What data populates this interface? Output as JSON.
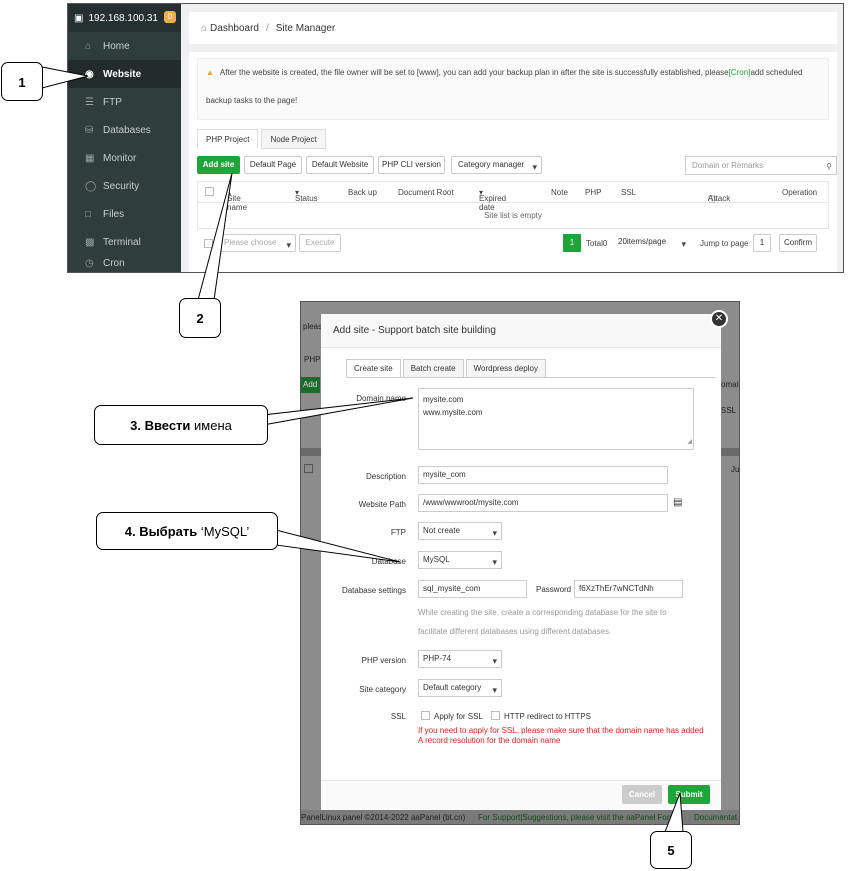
{
  "panel1": {
    "sidebar": {
      "ip": "192.168.100.31",
      "badge": "0",
      "items": [
        {
          "label": "Home",
          "icon": "home-icon"
        },
        {
          "label": "Website",
          "icon": "globe-icon"
        },
        {
          "label": "FTP",
          "icon": "ftp-icon"
        },
        {
          "label": "Databases",
          "icon": "database-icon"
        },
        {
          "label": "Monitor",
          "icon": "monitor-icon"
        },
        {
          "label": "Security",
          "icon": "shield-icon"
        },
        {
          "label": "Files",
          "icon": "folder-icon"
        },
        {
          "label": "Terminal",
          "icon": "terminal-icon"
        },
        {
          "label": "Cron",
          "icon": "cron-icon"
        }
      ]
    },
    "breadcrumb": {
      "home": "Dashboard",
      "sep": "/",
      "current": "Site Manager"
    },
    "notice": {
      "part1": "After the website is created, the file owner will be set to [www], you can add your backup plan in after the site is successfully established, please",
      "cron_link": "[Cron]",
      "part2": "add scheduled",
      "line2": "backup tasks to the page!"
    },
    "tabs": [
      "PHP Project",
      "Node Project"
    ],
    "toolbar": {
      "add_site": "Add site",
      "default_page": "Default Page",
      "default_website": "Default Website",
      "php_cli": "PHP CLI version",
      "category_manager": "Category manager",
      "search_placeholder": "Domain or Remarks"
    },
    "table": {
      "columns": [
        "Site name",
        "Status",
        "Back up",
        "Document Root",
        "Expired date",
        "Note",
        "PHP",
        "SSL",
        "Attack",
        "Operation"
      ],
      "empty": "Site list is empty"
    },
    "footer": {
      "please_choose": "Please choose",
      "execute": "Execute",
      "page": "1",
      "total": "Total0",
      "per_page": "20items/page",
      "jump_to": "Jump to page",
      "jump_value": "1",
      "confirm": "Confirm"
    }
  },
  "panel2": {
    "title": "Add site - Support batch site building",
    "tabs": [
      "Create site",
      "Batch create",
      "Wordpress deploy"
    ],
    "domain_label": "Domain name",
    "domain_value_1": "mysite.com",
    "domain_value_2": "www.mysite.com",
    "description_label": "Description",
    "description_value": "mysite_com",
    "path_label": "Website Path",
    "path_value": "/www/wwwroot/mysite.com",
    "ftp_label": "FTP",
    "ftp_value": "Not create",
    "database_label": "Database",
    "database_value": "MySQL",
    "db_settings_label": "Database settings",
    "db_name_value": "sql_mysite_com",
    "password_label": "Password",
    "password_value": "f6XzThEr7wNCTdNh",
    "db_hint_1": "While creating the site, create a corresponding database for the site to",
    "db_hint_2": "facilitate different databases using different databases.",
    "php_label": "PHP version",
    "php_value": "PHP-74",
    "category_label": "Site category",
    "category_value": "Default category",
    "ssl_label": "SSL",
    "apply_ssl": "Apply for SSL",
    "http_redirect": "HTTP redirect to HTTPS",
    "ssl_warning": "If you need to apply for SSL, please make sure that the domain name has added A record resolution for the domain name",
    "cancel": "Cancel",
    "submit": "Submit",
    "bg_fragments": {
      "please": "pleas",
      "php": "PHP",
      "add": "Add",
      "domain": "omain",
      "ssl": "SSL",
      "ju": "Ju"
    },
    "bottom_bar": {
      "copyright": "PanelLinux panel ©2014-2022 aaPanel (bt.cn)",
      "support": "For Support|Suggestions, please visit the aaPanel Forum",
      "docs": "Documentat"
    }
  },
  "callouts": {
    "c1": "1",
    "c2": "2",
    "c3_bold": "3. Ввести",
    "c3_rest": " имена",
    "c4_bold": "4. Выбрать",
    "c4_rest": " ‘MySQL’",
    "c5": "5"
  },
  "colors": {
    "accent_green": "#20a53a",
    "sidebar": "#2f3d3b",
    "warning_red": "#e02020"
  }
}
